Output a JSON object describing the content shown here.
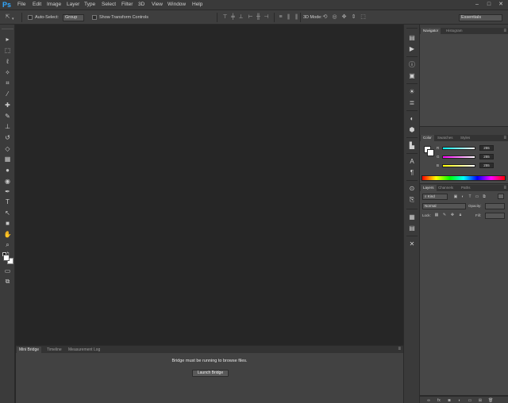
{
  "app": {
    "logo": "Ps"
  },
  "menu": [
    "File",
    "Edit",
    "Image",
    "Layer",
    "Type",
    "Select",
    "Filter",
    "3D",
    "View",
    "Window",
    "Help"
  ],
  "window_controls": [
    "–",
    "□",
    "✕"
  ],
  "options": {
    "auto_select_label": "Auto-Select:",
    "auto_select_value": "Group",
    "show_transform_label": "Show Transform Controls",
    "mode_3d_label": "3D Mode:",
    "workspace_value": "Essentials"
  },
  "tools": [
    "move-icon",
    "marquee-icon",
    "lasso-icon",
    "magic-wand-icon",
    "crop-icon",
    "eyedropper-icon",
    "healing-brush-icon",
    "brush-icon",
    "clone-stamp-icon",
    "history-brush-icon",
    "eraser-icon",
    "gradient-icon",
    "blur-icon",
    "dodge-icon",
    "pen-icon",
    "type-icon",
    "path-selection-icon",
    "rectangle-icon",
    "hand-icon",
    "zoom-icon"
  ],
  "colors": {
    "foreground": "#ffffff",
    "background": "#ffffff",
    "accent": "#31a8ff"
  },
  "bottom_panel": {
    "tabs": [
      "Mini Bridge",
      "Timeline",
      "Measurement Log"
    ],
    "message": "Bridge must be running to browse files.",
    "button": "Launch Bridge"
  },
  "dock_icons": [
    "history-icon",
    "actions-icon",
    "info-icon",
    "properties-icon",
    "adjustments-icon",
    "styles-icon",
    "3d-icon",
    "brush-presets-icon",
    "character-icon",
    "paragraph-icon",
    "clone-source-icon",
    "tool-presets-icon",
    "notes-icon",
    "layer-comps-icon",
    "channels-icon"
  ],
  "navigator": {
    "tabs": [
      "Navigator",
      "Histogram"
    ]
  },
  "color_panel": {
    "tabs": [
      "Color",
      "Swatches",
      "Styles"
    ],
    "sliders": [
      {
        "label": "R",
        "value": "255"
      },
      {
        "label": "G",
        "value": "255"
      },
      {
        "label": "B",
        "value": "255"
      }
    ]
  },
  "layers_panel": {
    "tabs": [
      "Layers",
      "Channels",
      "Paths"
    ],
    "kind_label": "Kind",
    "blend_mode": "Normal",
    "opacity_label": "Opacity:",
    "lock_label": "Lock:",
    "fill_label": "Fill:"
  }
}
